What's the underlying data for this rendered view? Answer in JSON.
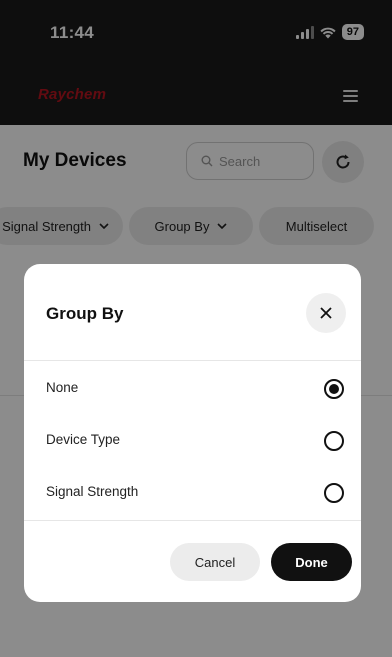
{
  "status_bar": {
    "time": "11:44",
    "battery": "97",
    "icons": [
      "signal-icon",
      "wifi-icon",
      "battery-icon"
    ]
  },
  "header": {
    "brand": "Raychem",
    "brand_color": "#b3141f",
    "menu_icon": "hamburger-menu-icon"
  },
  "page": {
    "title": "My Devices",
    "search_placeholder": "Search",
    "refresh_icon": "refresh-icon",
    "filters": [
      {
        "label": "Signal Strength",
        "has_dropdown": true
      },
      {
        "label": "Group By",
        "has_dropdown": true
      },
      {
        "label": "Multiselect",
        "has_dropdown": false
      }
    ]
  },
  "modal": {
    "title": "Group By",
    "close_icon": "close-icon",
    "options": [
      {
        "label": "None",
        "selected": true
      },
      {
        "label": "Device Type",
        "selected": false
      },
      {
        "label": "Signal Strength",
        "selected": false
      }
    ],
    "cancel_label": "Cancel",
    "done_label": "Done"
  }
}
